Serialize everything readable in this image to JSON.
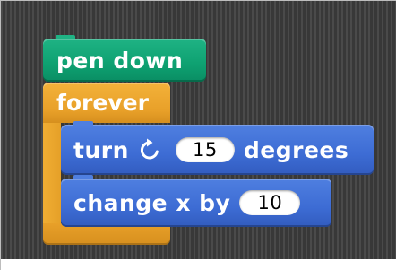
{
  "blocks": {
    "pen_down": {
      "label": "pen down",
      "color": "#0fa674"
    },
    "forever": {
      "label": "forever",
      "color": "#e9a12a"
    },
    "turn": {
      "prefix": "turn",
      "icon": "rotate-clockwise-icon",
      "value": "15",
      "suffix": "degrees",
      "color": "#416fd8"
    },
    "change_x": {
      "prefix": "change x by",
      "value": "10",
      "color": "#416fd8"
    }
  }
}
